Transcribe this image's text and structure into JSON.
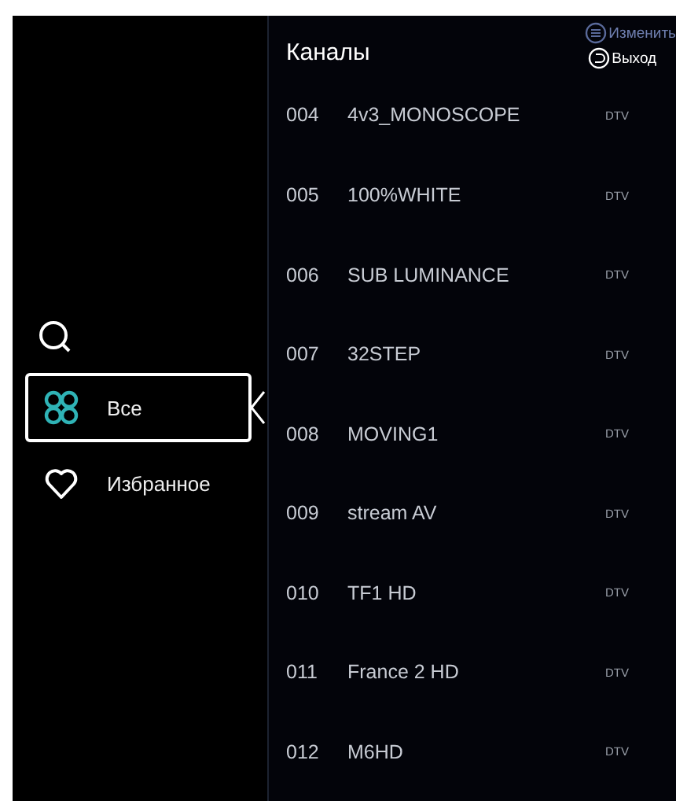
{
  "menu": {
    "items": [
      {
        "kind": "all",
        "label": "Все",
        "selected": true
      },
      {
        "kind": "favorites",
        "label": "Избранное",
        "selected": false
      }
    ]
  },
  "channels": {
    "title": "Каналы",
    "actions": [
      {
        "kind": "edit",
        "label": "Изменить"
      },
      {
        "kind": "exit",
        "label": "Выход"
      }
    ],
    "rows": [
      {
        "number": "004",
        "name": "4v3_MONOSCOPE",
        "type": "DTV"
      },
      {
        "number": "005",
        "name": "100%WHITE",
        "type": "DTV"
      },
      {
        "number": "006",
        "name": "SUB LUMINANCE",
        "type": "DTV"
      },
      {
        "number": "007",
        "name": "32STEP",
        "type": "DTV"
      },
      {
        "number": "008",
        "name": "MOVING1",
        "type": "DTV"
      },
      {
        "number": "009",
        "name": "stream AV",
        "type": "DTV"
      },
      {
        "number": "010",
        "name": "TF1 HD",
        "type": "DTV"
      },
      {
        "number": "011",
        "name": "France 2 HD",
        "type": "DTV"
      },
      {
        "number": "012",
        "name": "M6HD",
        "type": "DTV"
      }
    ]
  }
}
